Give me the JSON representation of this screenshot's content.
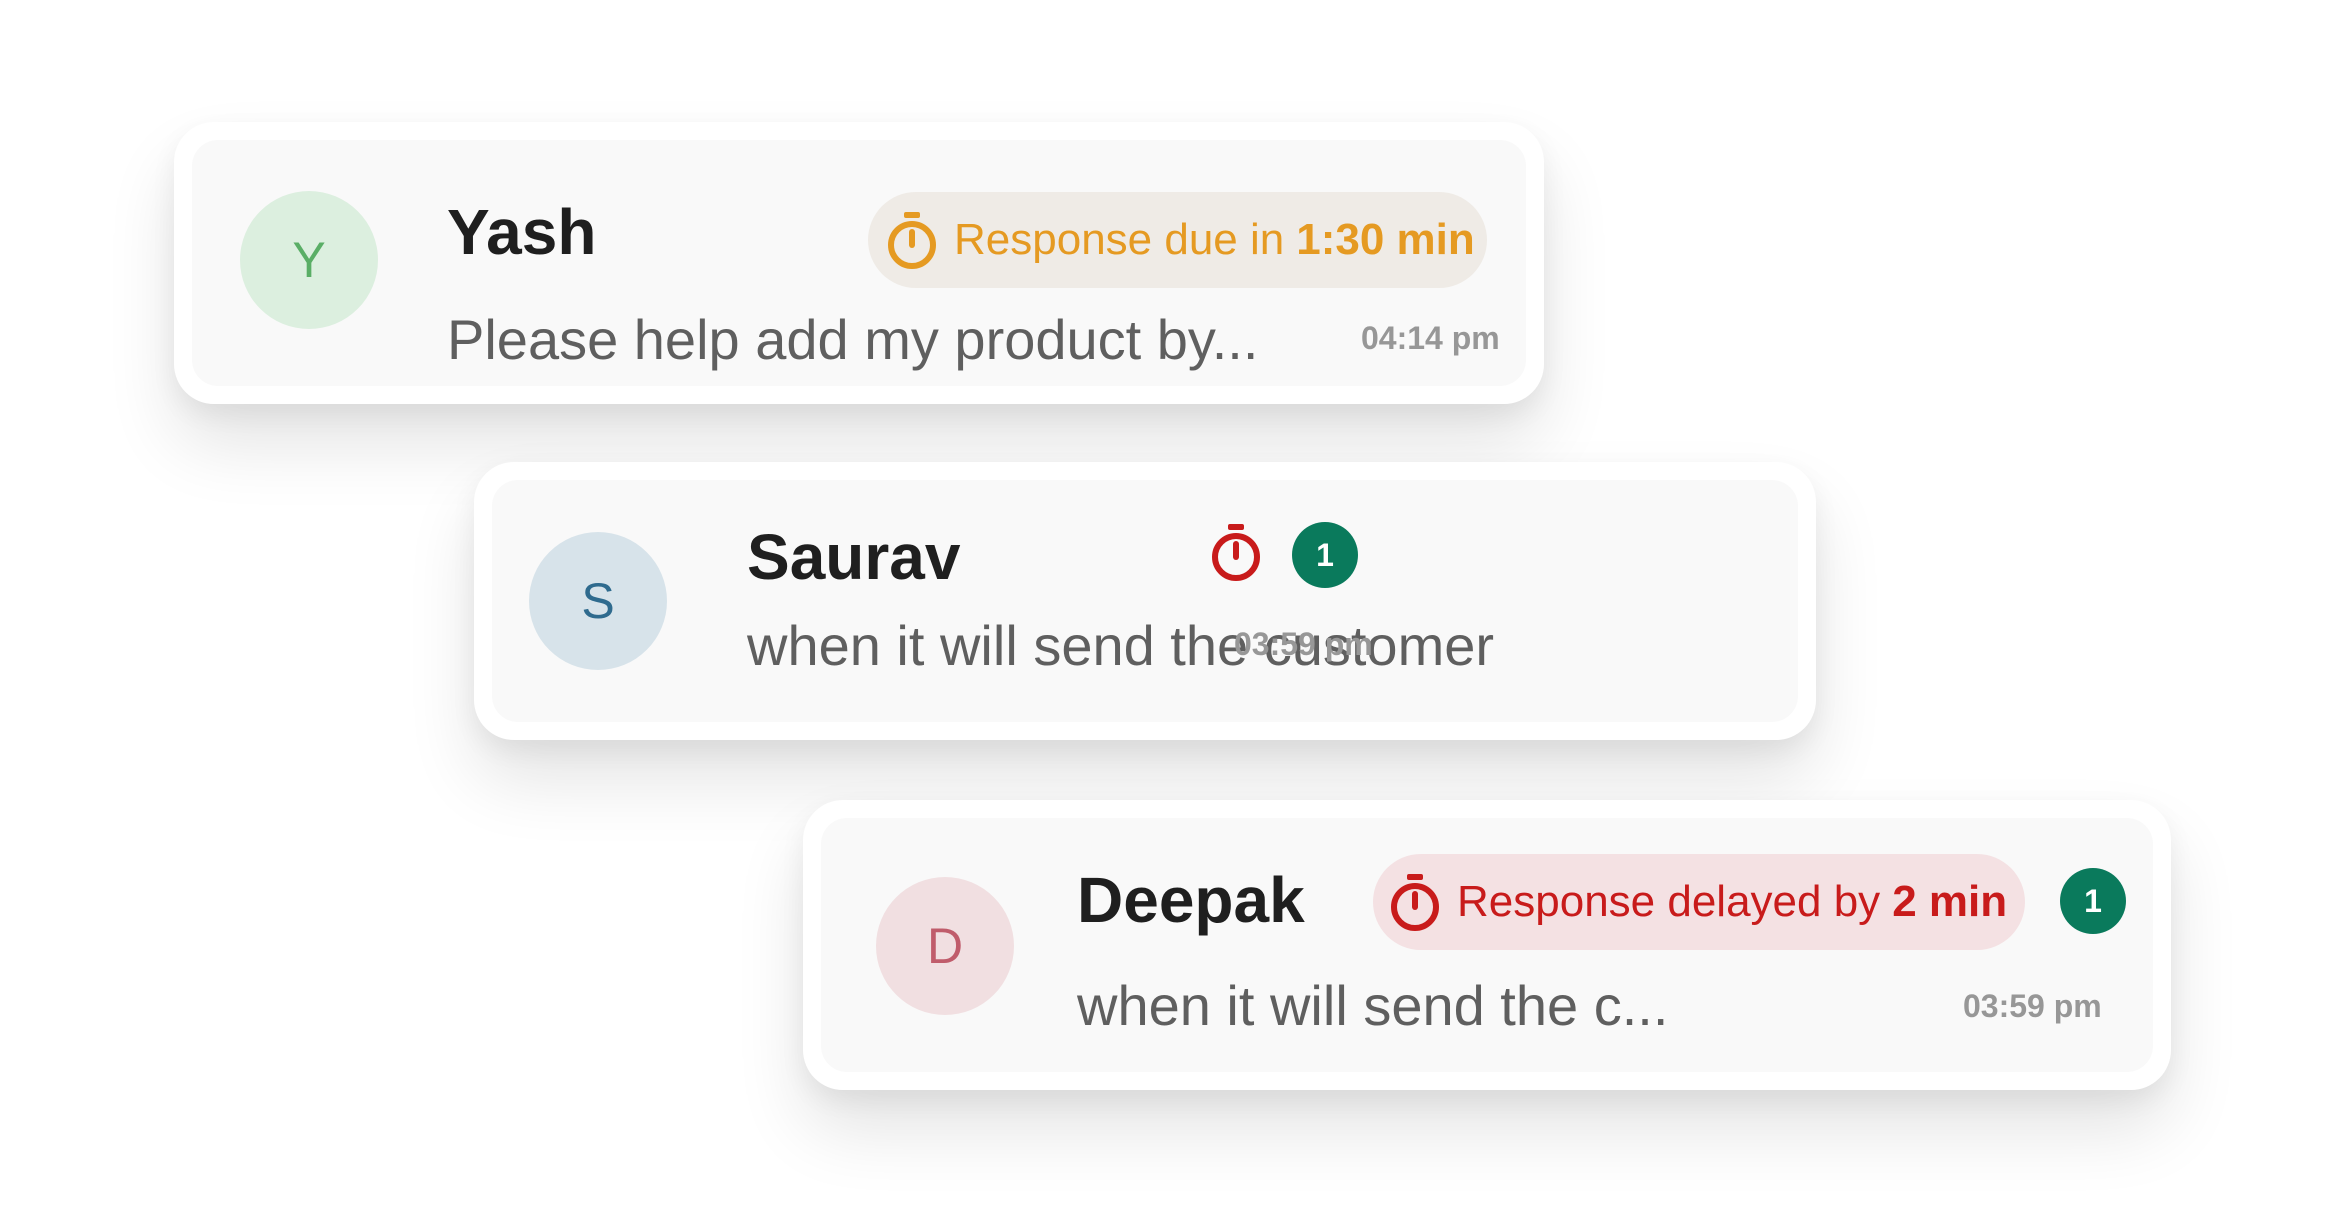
{
  "conversations": [
    {
      "avatar_initial": "Y",
      "name": "Yash",
      "preview": "Please help add my product by...",
      "time": "04:14 pm",
      "sla": {
        "status": "due",
        "prefix": "Response due in",
        "value": "1:30 min",
        "color": "#e59a22",
        "background": "#efebe6"
      },
      "avatar_colors": {
        "background": "#dcefdf",
        "text": "#5aae66"
      }
    },
    {
      "avatar_initial": "S",
      "name": "Saurav",
      "preview": "when it will send the customer",
      "time": "03:59 pm",
      "timer_icon_color": "#c81b1b",
      "unread_count": "1",
      "avatar_colors": {
        "background": "#d7e3ea",
        "text": "#2f6b8e"
      }
    },
    {
      "avatar_initial": "D",
      "name": "Deepak",
      "preview": "when it will send the c...",
      "time": "03:59 pm",
      "sla": {
        "status": "delayed",
        "prefix": "Response delayed by",
        "value": "2 min",
        "color": "#c81b1b",
        "background": "#f4e1e3"
      },
      "unread_count": "1",
      "avatar_colors": {
        "background": "#f1dfe1",
        "text": "#c05c6b"
      }
    }
  ],
  "badge_color": "#0a7a5c"
}
